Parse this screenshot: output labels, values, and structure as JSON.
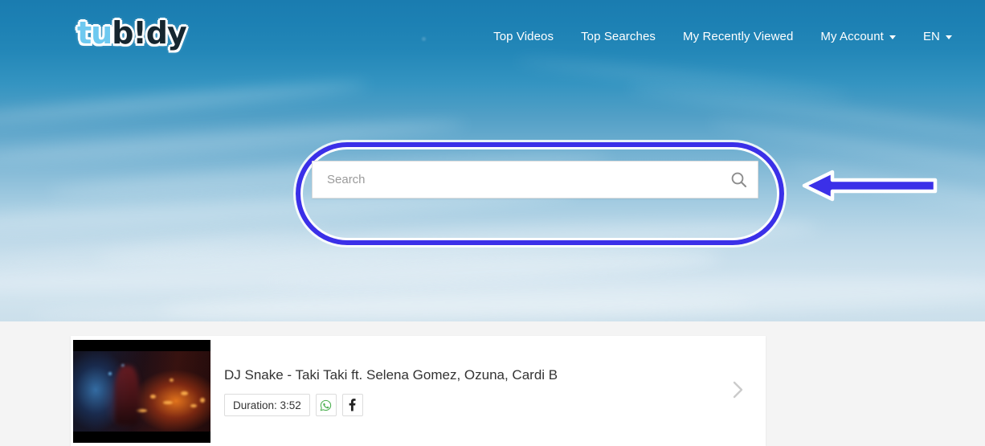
{
  "site": {
    "logo_part_a": "tu",
    "logo_part_b": "b!dy"
  },
  "nav": {
    "items": [
      {
        "label": "Top Videos",
        "has_caret": false
      },
      {
        "label": "Top Searches",
        "has_caret": false
      },
      {
        "label": "My Recently Viewed",
        "has_caret": false
      },
      {
        "label": "My Account",
        "has_caret": true
      },
      {
        "label": "EN",
        "has_caret": true
      }
    ]
  },
  "search": {
    "placeholder": "Search",
    "value": "",
    "button_icon": "search-icon"
  },
  "annotations": {
    "highlight_shape": "rounded-rectangle",
    "highlight_color": "#3b30e8",
    "highlight_outline_color": "#ffffff",
    "arrow_direction": "left",
    "arrow_color": "#3b30e8",
    "arrow_outline_color": "#ffffff"
  },
  "results": {
    "items": [
      {
        "title": "DJ Snake - Taki Taki ft. Selena Gomez, Ozuna, Cardi B",
        "duration_label": "Duration: 3:52",
        "share_whatsapp_icon": "whatsapp-icon",
        "share_facebook_icon": "facebook-icon",
        "expand_icon": "chevron-right-icon",
        "thumbnail_alt": "music-video-thumbnail"
      }
    ]
  },
  "colors": {
    "sky_top": "#1a7cb0",
    "sky_bottom": "#cbdfeb",
    "content_bg": "#f4f4f4",
    "card_bg": "#ffffff",
    "nav_text": "#ffffff",
    "logo_cyan": "#6ec9f0",
    "logo_navy": "#16262f",
    "whatsapp_green": "#4caf50",
    "facebook_dark": "#222222",
    "chevron_gray": "#cccccc"
  }
}
